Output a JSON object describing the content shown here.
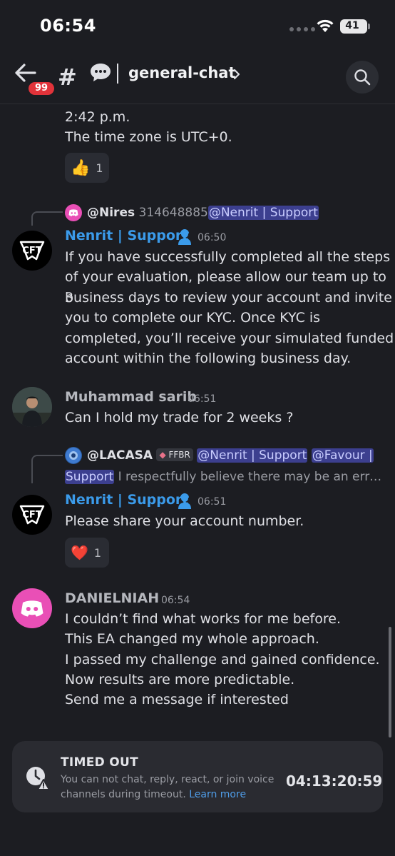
{
  "status": {
    "time": "06:54",
    "battery": "41"
  },
  "header": {
    "badge": "99",
    "hash": "#",
    "channel": "general-chat"
  },
  "messages": [
    {
      "tail_lines": [
        "2:42 p.m.",
        "The time zone is UTC+0."
      ],
      "reaction": {
        "emoji": "👍",
        "count": "1"
      }
    },
    {
      "reply": {
        "author": "@Nires",
        "text": "314648885",
        "mention": "@Nenrit | Support"
      },
      "author": "Nenrit | Support",
      "time": "06:50",
      "lines": [
        "If you have successfully completed all the steps",
        "of your evaluation, please allow our team up to 3",
        "business days to review your account and invite",
        "you to complete our KYC. Once KYC is",
        "completed, you’ll receive your simulated funded",
        "account within the following business day."
      ]
    },
    {
      "author": "Muhammad sarib",
      "time": "06:51",
      "lines": [
        "Can I hold my trade for 2 weeks ?"
      ]
    },
    {
      "reply": {
        "author": "@LACASA",
        "tag": "FFBR",
        "mention1": "@Nenrit | Support",
        "mention2a": "@Favour |",
        "mention2b": "Support",
        "text": "I respectfully believe there may be an err…"
      },
      "author": "Nenrit | Support",
      "time": "06:51",
      "lines": [
        "Please share your account number."
      ],
      "reaction": {
        "emoji": "❤️",
        "count": "1"
      }
    },
    {
      "author": "DANIELNIAH",
      "time": "06:54",
      "lines": [
        "I couldn’t find what works for me before.",
        "This EA changed my whole approach.",
        "I passed my challenge and gained confidence.",
        "Now results are more predictable.",
        "Send me a message if interested"
      ]
    }
  ],
  "timeout": {
    "title": "TIMED OUT",
    "desc": "You can not chat, reply, react, or join voice channels during timeout.",
    "link": "Learn more",
    "timer": "04:13:20:59"
  },
  "colors": {
    "background": "#1c1d22",
    "accent": "#3b9bea",
    "mention_bg": "#3c3f8f",
    "badge": "#e2333a"
  }
}
